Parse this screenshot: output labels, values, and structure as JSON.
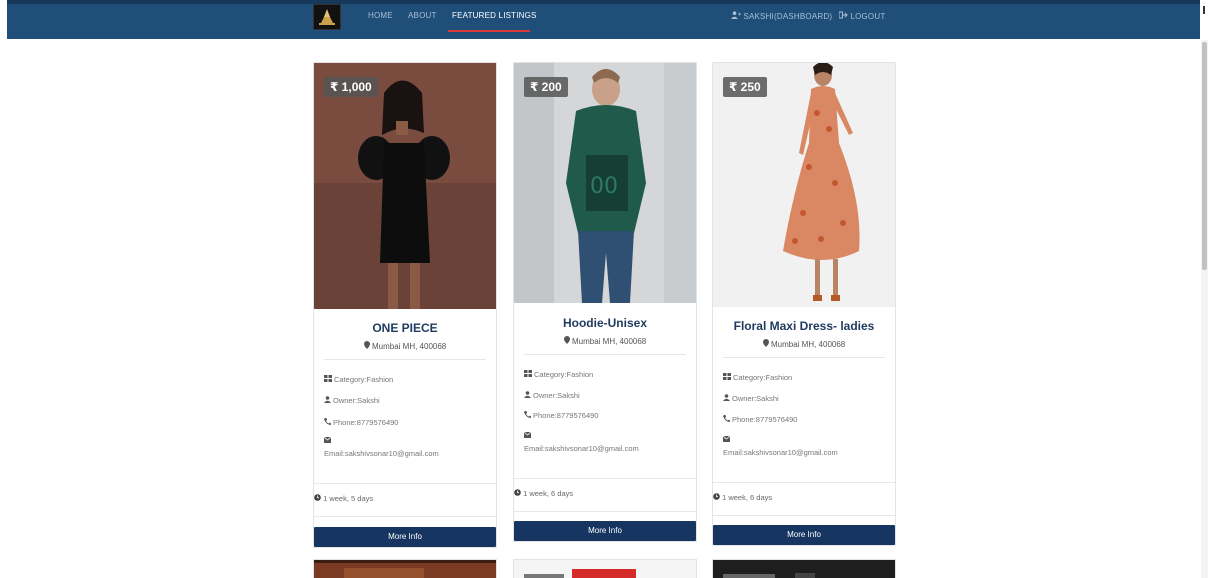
{
  "nav": {
    "home": "HOME",
    "about": "ABOUT",
    "featured": "FEATURED LISTINGS",
    "dashboard": "SAKSHI(DASHBOARD)",
    "logout": "LOGOUT"
  },
  "listings": [
    {
      "price": "₹ 1,000",
      "title": "ONE PIECE",
      "location": "Mumbai MH, 400068",
      "category": "Category:Fashion",
      "owner": "Owner:Sakshi",
      "phone": "Phone:8779576490",
      "email": "Email:sakshivsonar10@gmail.com",
      "time": "1 week, 5 days",
      "button": "More Info"
    },
    {
      "price": "₹ 200",
      "title": "Hoodie-Unisex",
      "location": "Mumbai MH, 400068",
      "category": "Category:Fashion",
      "owner": "Owner:Sakshi",
      "phone": "Phone:8779576490",
      "email": "Email:sakshivsonar10@gmail.com",
      "time": "1 week, 6 days",
      "button": "More Info"
    },
    {
      "price": "₹ 250",
      "title": "Floral Maxi Dress- ladies",
      "location": "Mumbai MH, 400068",
      "category": "Category:Fashion",
      "owner": "Owner:Sakshi",
      "phone": "Phone:8779576490",
      "email": "Email:sakshivsonar10@gmail.com",
      "time": "1 week, 6 days",
      "button": "More Info"
    }
  ],
  "icons": {
    "logo": "logo-icon",
    "user": "user-plus-icon",
    "logout": "sign-out-icon",
    "location": "map-marker-icon",
    "category": "grid-icon",
    "owner": "user-icon",
    "phone": "phone-icon",
    "email": "envelope-icon",
    "time": "clock-icon"
  },
  "colors": {
    "navbar": "#1f4e79",
    "button": "#163560",
    "accent": "#d63a3a"
  }
}
